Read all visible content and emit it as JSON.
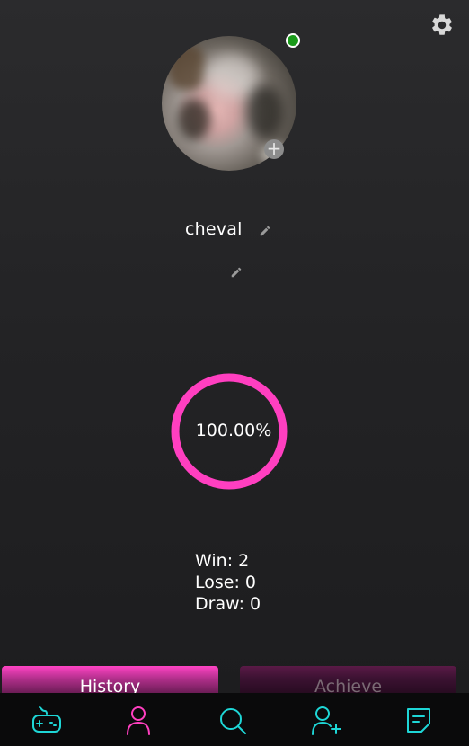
{
  "profile": {
    "username": "cheval",
    "online": true
  },
  "stats": {
    "win_rate_label": "100.00%",
    "win_rate": 1.0,
    "win_label": "Win: 2",
    "lose_label": "Lose: 0",
    "draw_label": "Draw: 0"
  },
  "tabs": {
    "history_label": "History",
    "achieve_label": "Achieve",
    "active": "History"
  },
  "nav": {
    "items": [
      "gamepad-icon",
      "profile-icon",
      "search-icon",
      "add-friend-icon",
      "chat-icon"
    ],
    "active": "profile-icon"
  },
  "colors": {
    "accent_pink": "#ff3fc0",
    "accent_cyan": "#1ed6d6",
    "online_green": "#1a9a1a"
  }
}
